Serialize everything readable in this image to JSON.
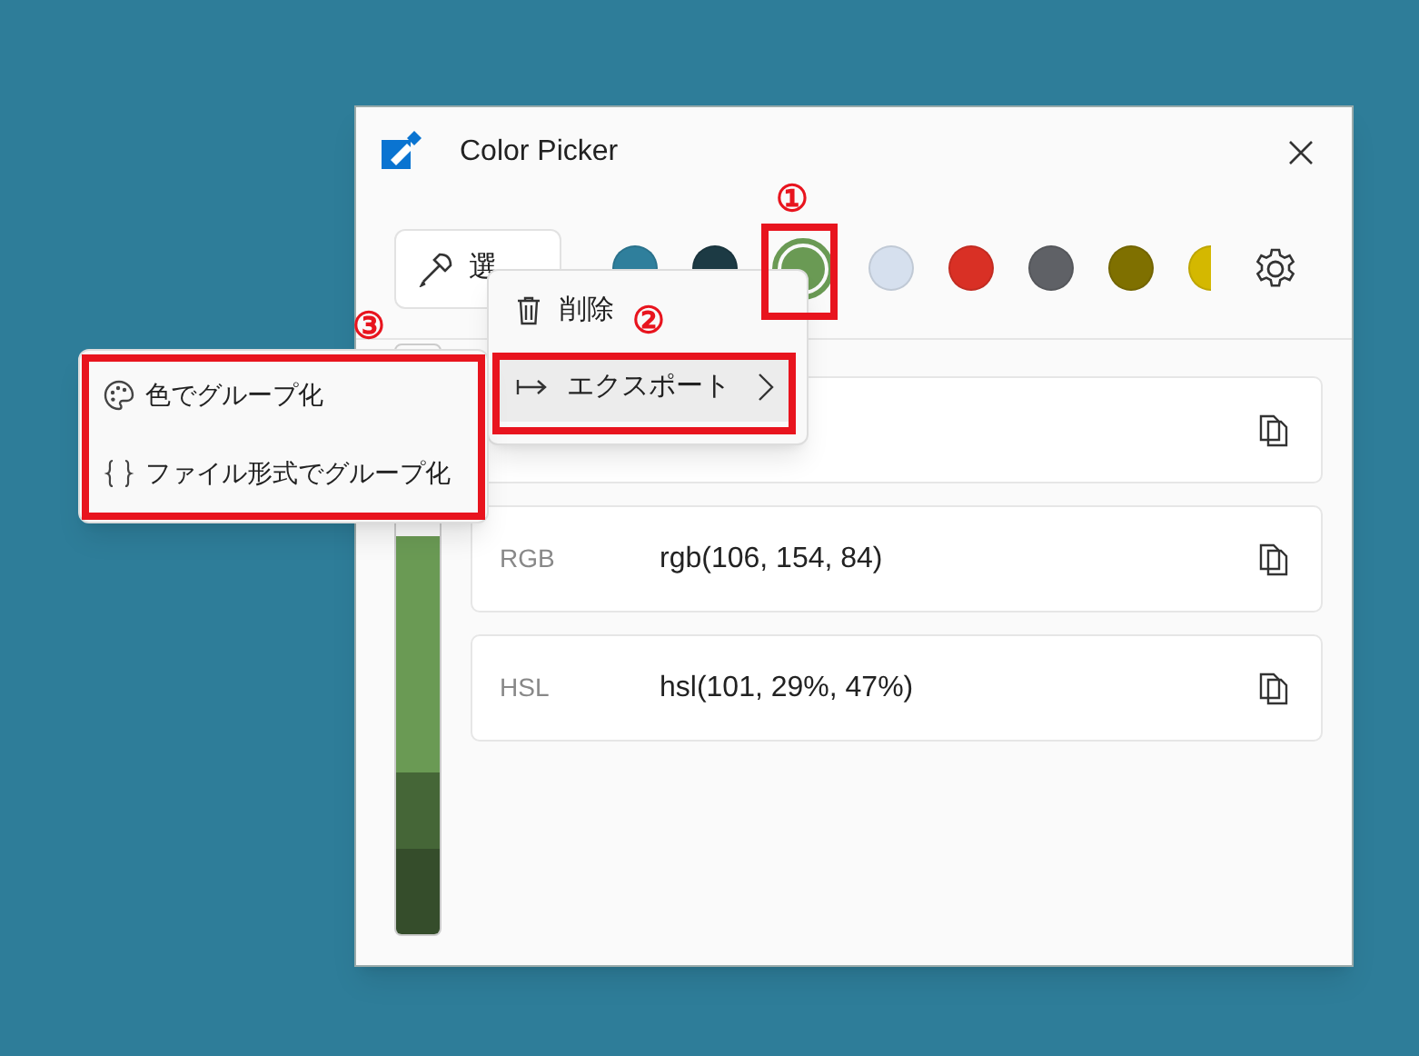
{
  "window": {
    "title": "Color Picker"
  },
  "pick_button": {
    "label": "選"
  },
  "swatches": [
    {
      "color": "#2f7f9c",
      "selected": false
    },
    {
      "color": "#1c3a44",
      "selected": false
    },
    {
      "color": "#6a9a54",
      "selected": true
    },
    {
      "color": "#d6e0ee",
      "selected": false
    },
    {
      "color": "#d93025",
      "selected": false
    },
    {
      "color": "#5f6166",
      "selected": false
    },
    {
      "color": "#7f7000",
      "selected": false
    },
    {
      "color": "#d4b800",
      "selected": false
    }
  ],
  "shade_bar": [
    {
      "color": "#6a9a54"
    },
    {
      "color": "#456637"
    },
    {
      "color": "#354d2b"
    }
  ],
  "formats": [
    {
      "kind": "covered"
    },
    {
      "kind": "value",
      "label": "RGB",
      "value": "rgb(106, 154, 84)"
    },
    {
      "kind": "value",
      "label": "HSL",
      "value": "hsl(101, 29%, 47%)"
    }
  ],
  "context_menu": [
    {
      "kind": "delete",
      "label": "削除",
      "highlighted": false
    },
    {
      "kind": "export",
      "label": "エクスポート",
      "highlighted": true
    }
  ],
  "submenu": [
    {
      "kind": "palette",
      "label": "色でグループ化"
    },
    {
      "kind": "braces",
      "label": "ファイル形式でグループ化"
    }
  ],
  "annotations": [
    {
      "label": "①"
    },
    {
      "label": "②"
    },
    {
      "label": "③"
    }
  ]
}
